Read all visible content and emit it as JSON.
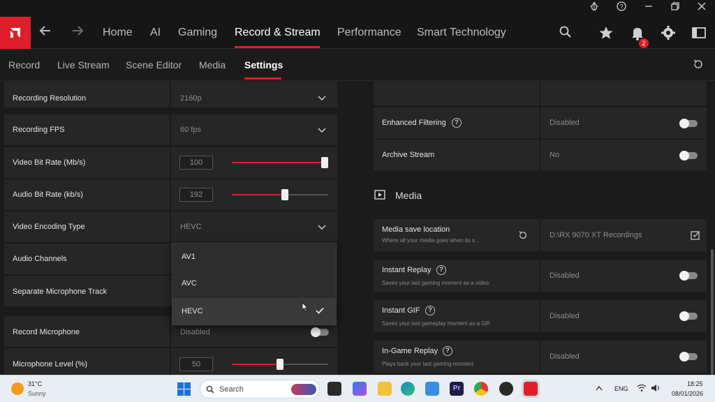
{
  "titlebar": {
    "icons": [
      "bug-icon",
      "help-icon",
      "minimize-icon",
      "restore-icon",
      "close-icon"
    ]
  },
  "nav": {
    "items": [
      "Home",
      "AI",
      "Gaming",
      "Record & Stream",
      "Performance",
      "Smart Technology"
    ],
    "active": "Record & Stream",
    "notification_count": "2",
    "accent": "#e01e2b"
  },
  "subnav": {
    "items": [
      "Record",
      "Live Stream",
      "Scene Editor",
      "Media",
      "Settings"
    ],
    "active": "Settings"
  },
  "left": {
    "recording_resolution": {
      "label": "Recording Resolution",
      "value": "2160p"
    },
    "recording_fps": {
      "label": "Recording FPS",
      "value": "60 fps"
    },
    "video_bit_rate": {
      "label": "Video Bit Rate (Mb/s)",
      "value": "100",
      "level": 1.0
    },
    "audio_bit_rate": {
      "label": "Audio Bit Rate (kb/s)",
      "value": "192",
      "level": 0.55
    },
    "video_encoding_type": {
      "label": "Video Encoding Type",
      "value": "HEVC"
    },
    "audio_channels": {
      "label": "Audio Channels"
    },
    "separate_mic_track": {
      "label": "Separate Microphone Track"
    },
    "record_microphone": {
      "label": "Record Microphone",
      "value": "Disabled"
    },
    "microphone_level": {
      "label": "Microphone Level (%)",
      "value": "50",
      "level": 0.5
    }
  },
  "dropdown": {
    "options": [
      "AV1",
      "AVC",
      "HEVC"
    ],
    "selected": "HEVC"
  },
  "right": {
    "enhanced_filtering": {
      "label": "Enhanced Filtering",
      "value": "Disabled"
    },
    "archive_stream": {
      "label": "Archive Stream",
      "value": "No"
    },
    "media_section": "Media",
    "media_save_location": {
      "label": "Media save location",
      "desc": "Where all your media goes when its s...",
      "value": "D:\\RX 9070 XT Recordings"
    },
    "instant_replay": {
      "label": "Instant Replay",
      "desc": "Saves your last gaming moment as a video.",
      "value": "Disabled"
    },
    "instant_gif": {
      "label": "Instant GIF",
      "desc": "Saves your last gameplay moment as a GIF.",
      "value": "Disabled"
    },
    "in_game_replay": {
      "label": "In-Game Replay",
      "desc": "Plays back your last gaming moment.",
      "value": "Disabled"
    }
  },
  "taskbar": {
    "weather_temp": "31°C",
    "weather_desc": "Sunny",
    "search_placeholder": "Search",
    "lang": "ENG",
    "time": "18:25",
    "date": "08/01/2026"
  }
}
